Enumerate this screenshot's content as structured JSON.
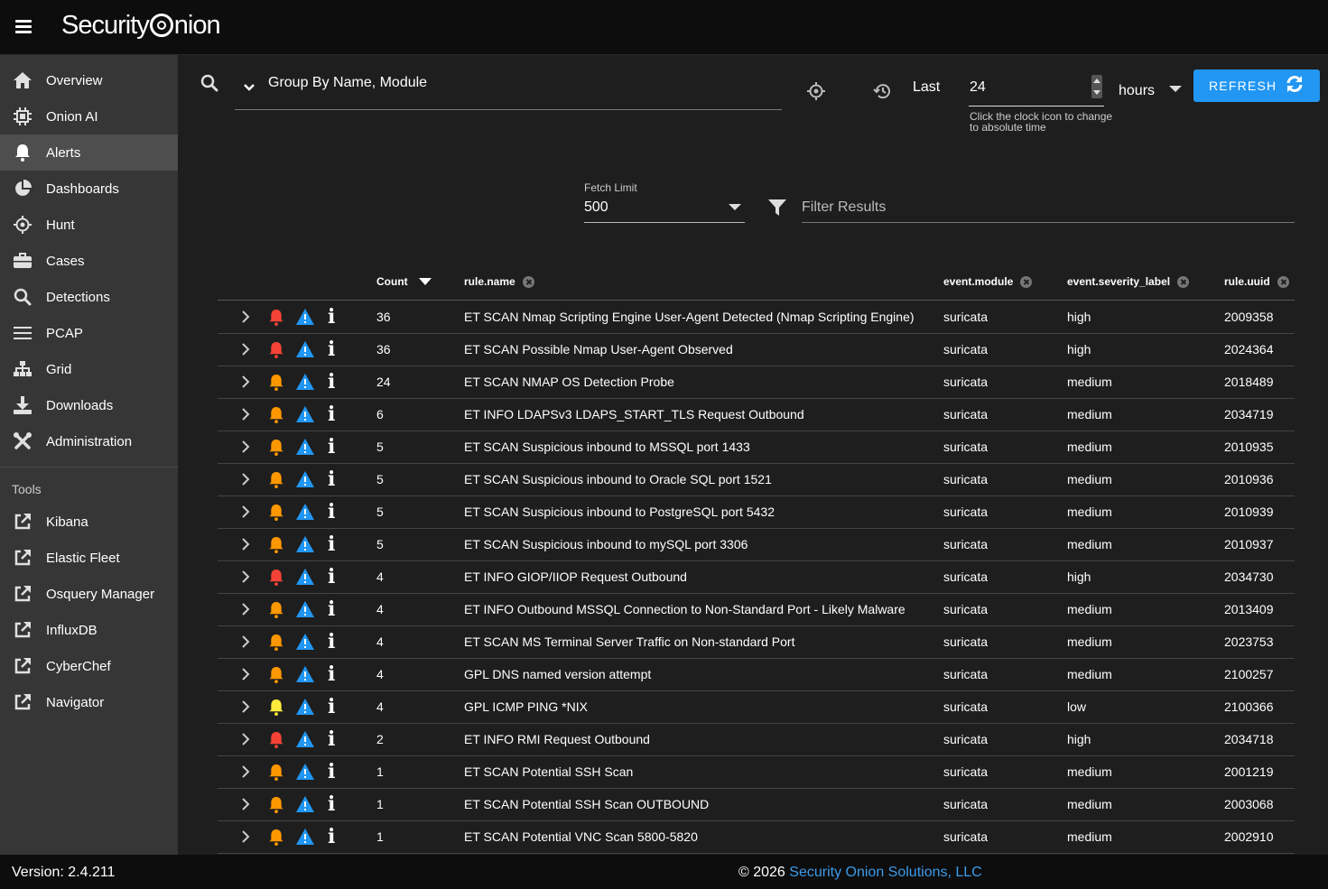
{
  "app": {
    "title": "Security Onion",
    "logo_left": "Security",
    "logo_right": "nion"
  },
  "sidebar": {
    "items": [
      {
        "label": "Overview",
        "icon": "home-icon"
      },
      {
        "label": "Onion AI",
        "icon": "chip-icon"
      },
      {
        "label": "Alerts",
        "icon": "bell-icon",
        "active": true
      },
      {
        "label": "Dashboards",
        "icon": "pie-chart-icon"
      },
      {
        "label": "Hunt",
        "icon": "crosshairs-icon"
      },
      {
        "label": "Cases",
        "icon": "briefcase-icon"
      },
      {
        "label": "Detections",
        "icon": "search-icon"
      },
      {
        "label": "PCAP",
        "icon": "list-icon"
      },
      {
        "label": "Grid",
        "icon": "sitemap-icon"
      },
      {
        "label": "Downloads",
        "icon": "download-icon"
      },
      {
        "label": "Administration",
        "icon": "tools-icon"
      }
    ],
    "tools_label": "Tools",
    "tools": [
      {
        "label": "Kibana",
        "icon": "external-link-icon"
      },
      {
        "label": "Elastic Fleet",
        "icon": "external-link-icon"
      },
      {
        "label": "Osquery Manager",
        "icon": "external-link-icon"
      },
      {
        "label": "InfluxDB",
        "icon": "external-link-icon"
      },
      {
        "label": "CyberChef",
        "icon": "external-link-icon"
      },
      {
        "label": "Navigator",
        "icon": "external-link-icon"
      }
    ]
  },
  "query": {
    "group_by": "Group By Name, Module"
  },
  "time": {
    "last_label": "Last",
    "value": "24",
    "hint": "Click the clock icon to change to absolute time",
    "unit": "hours",
    "refresh_label": "REFRESH"
  },
  "fetch": {
    "label": "Fetch Limit",
    "value": "500"
  },
  "filter": {
    "placeholder": "Filter Results"
  },
  "table": {
    "headers": {
      "count": "Count",
      "rule_name": "rule.name",
      "module": "event.module",
      "severity": "event.severity_label",
      "uuid": "rule.uuid"
    },
    "rows": [
      {
        "count": "36",
        "name": "ET SCAN Nmap Scripting Engine User-Agent Detected (Nmap Scripting Engine)",
        "module": "suricata",
        "severity": "high",
        "uuid": "2009358"
      },
      {
        "count": "36",
        "name": "ET SCAN Possible Nmap User-Agent Observed",
        "module": "suricata",
        "severity": "high",
        "uuid": "2024364"
      },
      {
        "count": "24",
        "name": "ET SCAN NMAP OS Detection Probe",
        "module": "suricata",
        "severity": "medium",
        "uuid": "2018489"
      },
      {
        "count": "6",
        "name": "ET INFO LDAPSv3 LDAPS_START_TLS Request Outbound",
        "module": "suricata",
        "severity": "medium",
        "uuid": "2034719"
      },
      {
        "count": "5",
        "name": "ET SCAN Suspicious inbound to MSSQL port 1433",
        "module": "suricata",
        "severity": "medium",
        "uuid": "2010935"
      },
      {
        "count": "5",
        "name": "ET SCAN Suspicious inbound to Oracle SQL port 1521",
        "module": "suricata",
        "severity": "medium",
        "uuid": "2010936"
      },
      {
        "count": "5",
        "name": "ET SCAN Suspicious inbound to PostgreSQL port 5432",
        "module": "suricata",
        "severity": "medium",
        "uuid": "2010939"
      },
      {
        "count": "5",
        "name": "ET SCAN Suspicious inbound to mySQL port 3306",
        "module": "suricata",
        "severity": "medium",
        "uuid": "2010937"
      },
      {
        "count": "4",
        "name": "ET INFO GIOP/IIOP Request Outbound",
        "module": "suricata",
        "severity": "high",
        "uuid": "2034730"
      },
      {
        "count": "4",
        "name": "ET INFO Outbound MSSQL Connection to Non-Standard Port - Likely Malware",
        "module": "suricata",
        "severity": "medium",
        "uuid": "2013409"
      },
      {
        "count": "4",
        "name": "ET SCAN MS Terminal Server Traffic on Non-standard Port",
        "module": "suricata",
        "severity": "medium",
        "uuid": "2023753"
      },
      {
        "count": "4",
        "name": "GPL DNS named version attempt",
        "module": "suricata",
        "severity": "medium",
        "uuid": "2100257"
      },
      {
        "count": "4",
        "name": "GPL ICMP PING *NIX",
        "module": "suricata",
        "severity": "low",
        "uuid": "2100366"
      },
      {
        "count": "2",
        "name": "ET INFO RMI Request Outbound",
        "module": "suricata",
        "severity": "high",
        "uuid": "2034718"
      },
      {
        "count": "1",
        "name": "ET SCAN Potential SSH Scan",
        "module": "suricata",
        "severity": "medium",
        "uuid": "2001219"
      },
      {
        "count": "1",
        "name": "ET SCAN Potential SSH Scan OUTBOUND",
        "module": "suricata",
        "severity": "medium",
        "uuid": "2003068"
      },
      {
        "count": "1",
        "name": "ET SCAN Potential VNC Scan 5800-5820",
        "module": "suricata",
        "severity": "medium",
        "uuid": "2002910"
      }
    ]
  },
  "colors": {
    "high": "#f44336",
    "medium": "#ff9800",
    "low": "#ffeb3b",
    "warn": "#2196f3",
    "accent": "#2196f3"
  },
  "footer": {
    "version": "Version: 2.4.211",
    "copyright_prefix": "© 2026",
    "company": "Security Onion Solutions, LLC"
  }
}
